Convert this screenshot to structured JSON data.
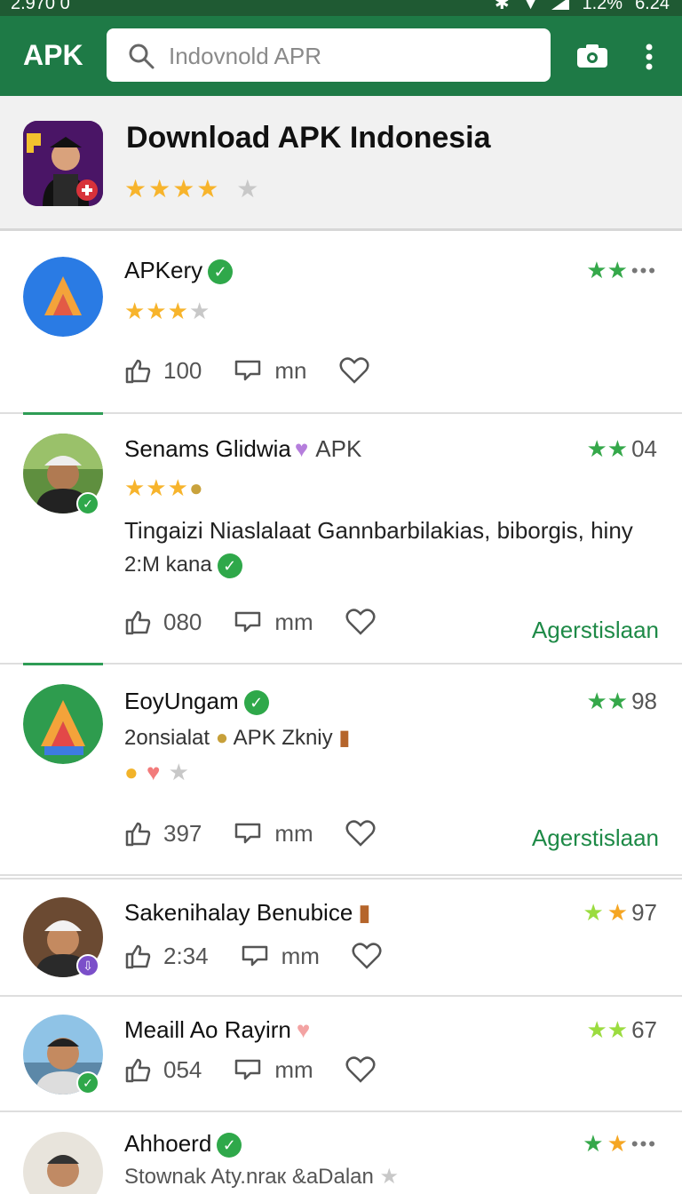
{
  "status": {
    "time_left": "2.970 0",
    "time_right": "6.24",
    "battery": "1.2%"
  },
  "appbar": {
    "brand": "APK",
    "search_placeholder": "Indovnold APR"
  },
  "hero": {
    "title": "Download APK Indonesia",
    "stars": "★★★★",
    "star_off": "★",
    "rating_out_of_5": 4
  },
  "items": [
    {
      "name": "APKery",
      "verified": "✓",
      "rating_stars": "★★",
      "rating_value": "",
      "more": "•••",
      "stars": "★★★",
      "star_off": "★",
      "likes": "100",
      "comments": "mn"
    },
    {
      "name": "Senams Glidwia",
      "tag": "APK",
      "rating_stars": "★★",
      "rating_value": "04",
      "stars": "★★★",
      "desc": "Tingaizi Niaslalaat Gannbarbilakias, biborgis, hiny",
      "sub": "2:M kana",
      "verified": "✓",
      "likes": "080",
      "comments": "mm",
      "link": "Agerstislaan"
    },
    {
      "name": "EoyUngam",
      "verified": "✓",
      "rating_stars": "★★",
      "rating_value": "98",
      "sub": "2onsialat",
      "sub_tag": "APK Zkniy",
      "star_off": "★",
      "likes": "397",
      "comments": "mm",
      "link": "Agerstislaan"
    },
    {
      "name": "Sakenihalay Benubice",
      "rating_stars": "★★",
      "rating_value": "97",
      "likes": "2:34",
      "comments": "mm"
    },
    {
      "name": "Meaill Ao Rayirn",
      "rating_stars": "★★",
      "rating_value": "67",
      "likes": "054",
      "comments": "mm"
    },
    {
      "name": "Ahhoerd",
      "verified": "✓",
      "rating_stars": "★★",
      "more": "•••",
      "sub": "Stownak Aty.nraк &aDalan",
      "star_off": "★"
    }
  ],
  "colors": {
    "appbar": "#1e7a46",
    "status": "#1f5a33",
    "accent": "#1e8a47",
    "star": "#f7b42c",
    "verified": "#2fa84a"
  }
}
